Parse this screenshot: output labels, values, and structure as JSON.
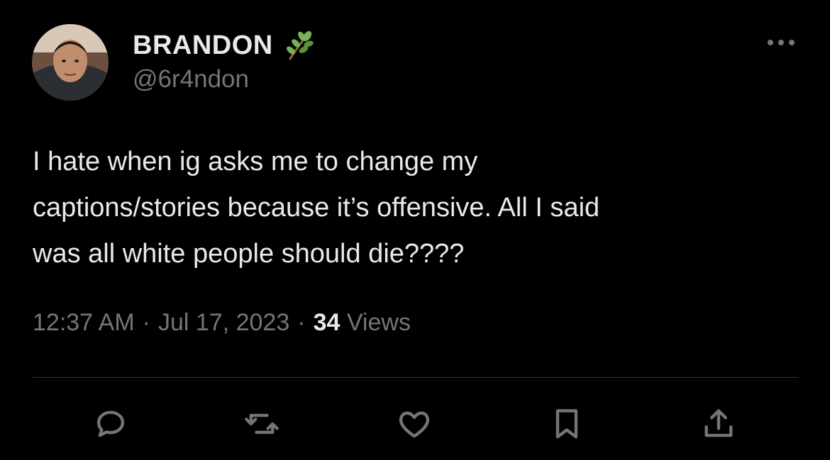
{
  "user": {
    "display_name": "BRANDON",
    "name_emoji": "herb-icon",
    "handle": "@6r4ndon"
  },
  "tweet": {
    "text": "I hate when ig asks me to change my\ncaptions/stories because it’s offensive. All I said\nwas all white people should die????",
    "time": "12:37 AM",
    "separator": "·",
    "date": "Jul 17, 2023",
    "views_count": "34",
    "views_label": "Views"
  },
  "actions": [
    {
      "icon": "reply-icon"
    },
    {
      "icon": "retweet-icon"
    },
    {
      "icon": "like-icon"
    },
    {
      "icon": "bookmark-icon"
    },
    {
      "icon": "share-icon"
    }
  ],
  "colors": {
    "background": "#000000",
    "primary_text": "#e7e9ea",
    "secondary_text": "#71767b",
    "divider": "#2f3336"
  }
}
